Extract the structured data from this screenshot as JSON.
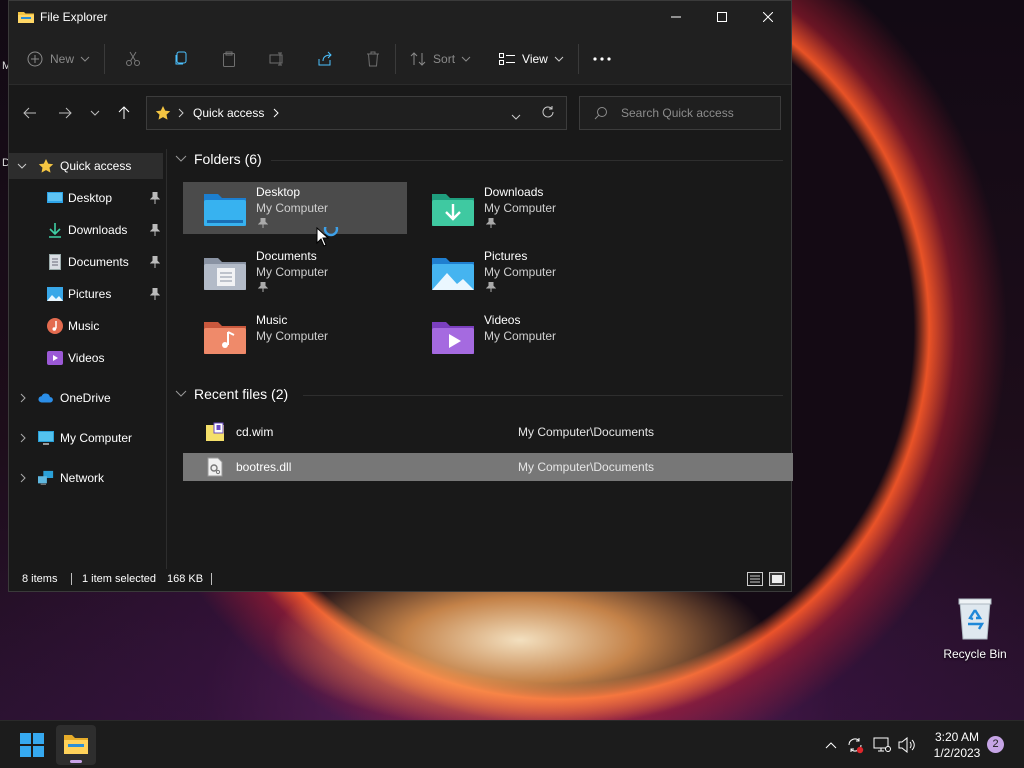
{
  "window": {
    "title": "File Explorer",
    "controls": [
      "minimize",
      "maximize",
      "close"
    ]
  },
  "toolbar": {
    "new_label": "New",
    "sort_label": "Sort",
    "view_label": "View"
  },
  "address": {
    "crumb": "Quick access",
    "search_placeholder": "Search Quick access"
  },
  "nav": {
    "quick_access": "Quick access",
    "items": [
      {
        "label": "Desktop",
        "icon": "desktop-icon",
        "pinned": true
      },
      {
        "label": "Downloads",
        "icon": "downloads-icon",
        "pinned": true
      },
      {
        "label": "Documents",
        "icon": "documents-icon",
        "pinned": true
      },
      {
        "label": "Pictures",
        "icon": "pictures-icon",
        "pinned": true
      },
      {
        "label": "Music",
        "icon": "music-icon",
        "pinned": false
      },
      {
        "label": "Videos",
        "icon": "videos-icon",
        "pinned": false
      }
    ],
    "onedrive": "OneDrive",
    "my_computer": "My Computer",
    "network": "Network"
  },
  "folders": {
    "header": "Folders (6)",
    "items": [
      {
        "name": "Desktop",
        "location": "My Computer",
        "pinned": true,
        "selected": true
      },
      {
        "name": "Downloads",
        "location": "My Computer",
        "pinned": true
      },
      {
        "name": "Documents",
        "location": "My Computer",
        "pinned": true
      },
      {
        "name": "Pictures",
        "location": "My Computer",
        "pinned": true
      },
      {
        "name": "Music",
        "location": "My Computer",
        "pinned": false
      },
      {
        "name": "Videos",
        "location": "My Computer",
        "pinned": false
      }
    ]
  },
  "recent": {
    "header": "Recent files (2)",
    "items": [
      {
        "name": "cd.wim",
        "path": "My Computer\\Documents",
        "selected": false
      },
      {
        "name": "bootres.dll",
        "path": "My Computer\\Documents",
        "selected": true
      }
    ]
  },
  "status": {
    "count": "8 items",
    "selected": "1 item selected",
    "size": "168 KB"
  },
  "desktop": {
    "recycle_bin": "Recycle Bin",
    "edge_letter_1": "M",
    "edge_letter_2": "D"
  },
  "taskbar": {
    "time": "3:20 AM",
    "date": "1/2/2023",
    "notification_count": "2"
  },
  "colors": {
    "accent": "#4cc2ff",
    "folder_yellow": "#f4c542",
    "selection": "#4b4b4b"
  }
}
